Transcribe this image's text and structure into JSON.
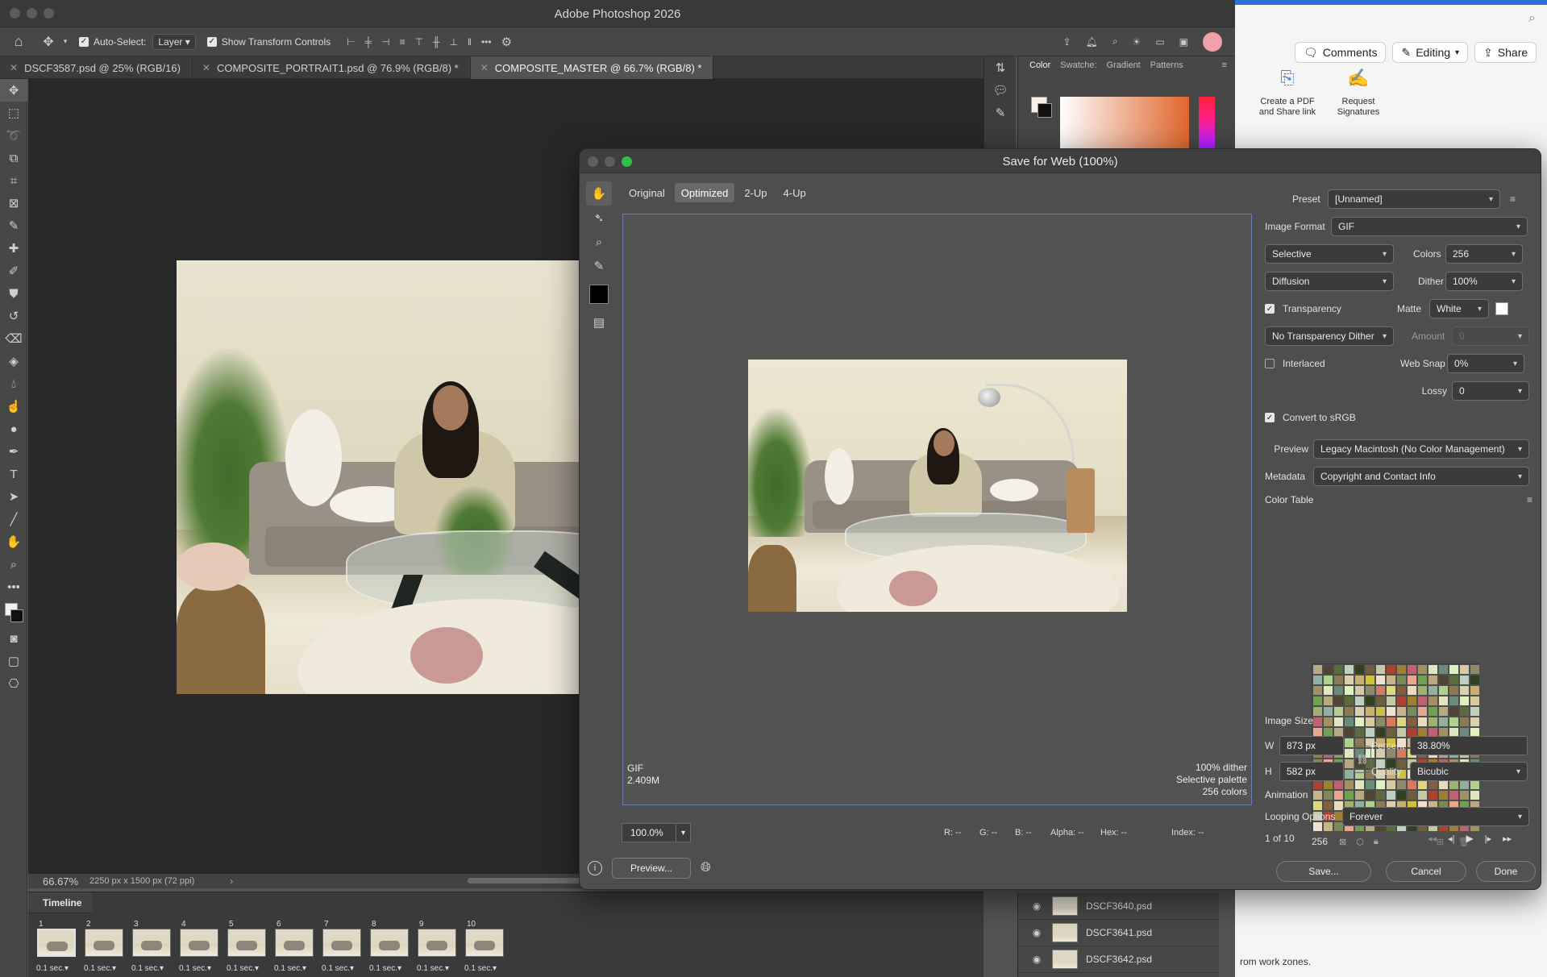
{
  "app": {
    "window_title": "Adobe Photoshop 2026"
  },
  "options_bar": {
    "auto_select_label": "Auto-Select:",
    "auto_select_value": "Layer",
    "show_transform_label": "Show Transform Controls"
  },
  "doc_tabs": [
    {
      "label": "DSCF3587.psd @ 25% (RGB/16)",
      "active": false
    },
    {
      "label": "COMPOSITE_PORTRAIT1.psd @ 76.9% (RGB/8) *",
      "active": false
    },
    {
      "label": "COMPOSITE_MASTER @ 66.7% (RGB/8) *",
      "active": true
    }
  ],
  "status": {
    "zoom": "66.67%",
    "doc_info": "2250 px x 1500 px (72 ppi)"
  },
  "timeline": {
    "title": "Timeline",
    "frames": [
      {
        "num": "1",
        "delay": "0.1 sec.",
        "selected": true
      },
      {
        "num": "2",
        "delay": "0.1 sec.",
        "selected": false
      },
      {
        "num": "3",
        "delay": "0.1 sec.",
        "selected": false
      },
      {
        "num": "4",
        "delay": "0.1 sec.",
        "selected": false
      },
      {
        "num": "5",
        "delay": "0.1 sec.",
        "selected": false
      },
      {
        "num": "6",
        "delay": "0.1 sec.",
        "selected": false
      },
      {
        "num": "7",
        "delay": "0.1 sec.",
        "selected": false
      },
      {
        "num": "8",
        "delay": "0.1 sec.",
        "selected": false
      },
      {
        "num": "9",
        "delay": "0.1 sec.",
        "selected": false
      },
      {
        "num": "10",
        "delay": "0.1 sec.",
        "selected": false
      }
    ]
  },
  "color_panel": {
    "tabs": [
      "Color",
      "Swatche:",
      "Gradient",
      "Patterns"
    ]
  },
  "layers": [
    {
      "name": "DSCF3640.psd"
    },
    {
      "name": "DSCF3641.psd"
    },
    {
      "name": "DSCF3642.psd"
    }
  ],
  "doc_window": {
    "comments_label": "Comments",
    "editing_label": "Editing",
    "share_label": "Share",
    "action1": "Create a PDF and Share link",
    "action2": "Request Signatures",
    "bottom_text": "rom work zones."
  },
  "dialog": {
    "title": "Save for Web (100%)",
    "view_tabs": [
      {
        "label": "Original",
        "active": false
      },
      {
        "label": "Optimized",
        "active": true
      },
      {
        "label": "2-Up",
        "active": false
      },
      {
        "label": "4-Up",
        "active": false
      }
    ],
    "preview_info_left": [
      "GIF",
      "2.409M"
    ],
    "preview_info_right": [
      "100% dither",
      "Selective palette",
      "256 colors"
    ],
    "zoom_value": "100.0%",
    "readouts": {
      "r": "R: --",
      "g": "G: --",
      "b": "B: --",
      "alpha": "Alpha: --",
      "hex": "Hex: --",
      "index": "Index: --"
    },
    "preview_button": "Preview...",
    "settings": {
      "preset_label": "Preset",
      "preset_value": "[Unnamed]",
      "format_label": "Image Format",
      "format_value": "GIF",
      "reduction_value": "Selective",
      "colors_label": "Colors",
      "colors_value": "256",
      "dither_algo_value": "Diffusion",
      "dither_label": "Dither",
      "dither_value": "100%",
      "transparency_label": "Transparency",
      "transparency_checked": true,
      "matte_label": "Matte",
      "matte_value": "White",
      "transp_dither_value": "No Transparency Dither",
      "amount_label": "Amount",
      "amount_value": "0",
      "interlaced_label": "Interlaced",
      "interlaced_checked": false,
      "websnap_label": "Web Snap",
      "websnap_value": "0%",
      "lossy_label": "Lossy",
      "lossy_value": "0",
      "srgb_label": "Convert to sRGB",
      "srgb_checked": true,
      "preview_label": "Preview",
      "preview_value": "Legacy Macintosh (No Color Management)",
      "metadata_label": "Metadata",
      "metadata_value": "Copyright and Contact Info",
      "color_table_label": "Color Table",
      "color_count": "256",
      "image_size_label": "Image Size",
      "w_label": "W",
      "w_value": "873 px",
      "h_label": "H",
      "h_value": "582 px",
      "percent_label": "Percent",
      "percent_value": "38.80%",
      "quality_label": "Quality",
      "quality_value": "Bicubic",
      "animation_label": "Animation",
      "looping_label": "Looping Options",
      "looping_value": "Forever",
      "frame_counter": "1 of 10"
    },
    "buttons": {
      "save": "Save...",
      "cancel": "Cancel",
      "done": "Done"
    }
  }
}
